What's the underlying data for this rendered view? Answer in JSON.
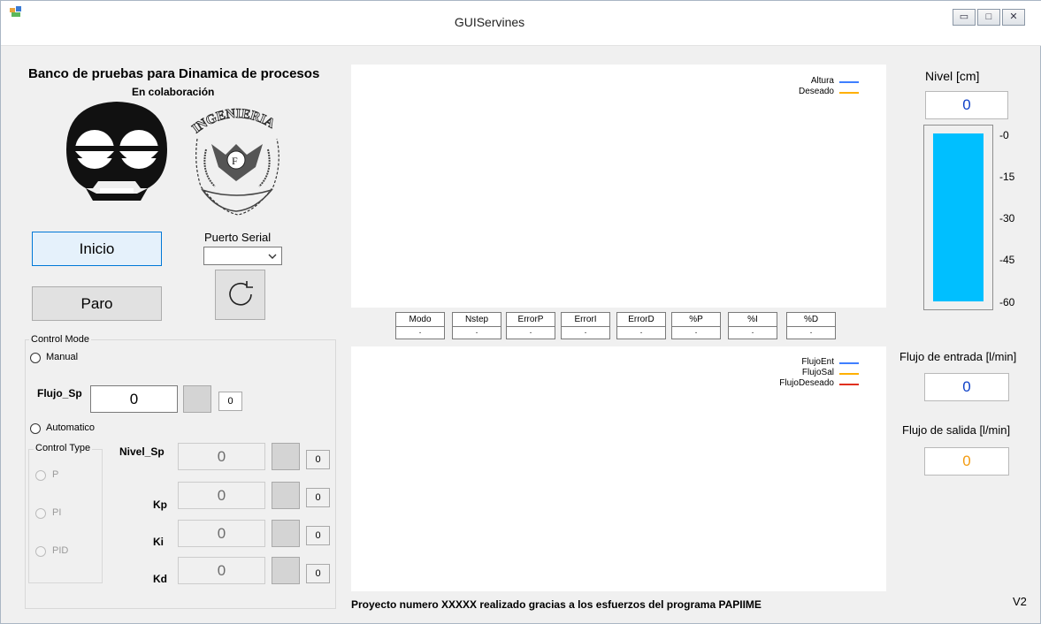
{
  "window": {
    "title": "GUIServines",
    "minimize_glyph": "▭",
    "maximize_glyph": "□",
    "close_glyph": "✕"
  },
  "header": {
    "title": "Banco de pruebas para Dinamica de procesos",
    "subtitle": "En colaboración",
    "seal_text": "INGENIERIA"
  },
  "controls": {
    "start_label": "Inicio",
    "stop_label": "Paro",
    "serial_port_label": "Puerto Serial",
    "serial_port_value": ""
  },
  "control_mode": {
    "title": "Control Mode",
    "manual_label": "Manual",
    "flujo_sp_label": "Flujo_Sp",
    "flujo_sp_value": "0",
    "flujo_sp_small": "0",
    "automatico_label": "Automatico",
    "control_type": {
      "title": "Control Type",
      "options": [
        "P",
        "PI",
        "PID"
      ]
    },
    "params": [
      {
        "label": "Nivel_Sp",
        "value": "0",
        "small": "0"
      },
      {
        "label": "Kp",
        "value": "0",
        "small": "0"
      },
      {
        "label": "Ki",
        "value": "0",
        "small": "0"
      },
      {
        "label": "Kd",
        "value": "0",
        "small": "0"
      }
    ]
  },
  "top_chart": {
    "legend": [
      {
        "name": "Altura",
        "color": "#3f7fff"
      },
      {
        "name": "Deseado",
        "color": "#ffb000"
      }
    ]
  },
  "bottom_chart": {
    "legend": [
      {
        "name": "FlujoEnt",
        "color": "#3f7fff"
      },
      {
        "name": "FlujoSal",
        "color": "#ffb000"
      },
      {
        "name": "FlujoDeseado",
        "color": "#e0301e"
      }
    ]
  },
  "status_table": {
    "columns": [
      {
        "header": "Modo",
        "value": "."
      },
      {
        "header": "Nstep",
        "value": "."
      },
      {
        "header": "ErrorP",
        "value": "."
      },
      {
        "header": "ErrorI",
        "value": "."
      },
      {
        "header": "ErrorD",
        "value": "."
      },
      {
        "header": "%P",
        "value": "."
      },
      {
        "header": "%I",
        "value": "."
      },
      {
        "header": "%D",
        "value": "."
      }
    ]
  },
  "level": {
    "label": "Nivel [cm]",
    "value": "0",
    "value_color": "#1042c8",
    "bar_color": "#00bfff",
    "ticks": [
      "-0",
      "-15",
      "-30",
      "-45",
      "-60"
    ]
  },
  "flow_in": {
    "label": "Flujo de entrada [l/min]",
    "value": "0",
    "color": "#1042c8"
  },
  "flow_out": {
    "label": "Flujo de salida [l/min]",
    "value": "0",
    "color": "#f39c12"
  },
  "footer": {
    "text": "Proyecto numero XXXXX realizado gracias a los esfuerzos del programa PAPIIME",
    "version": "V2"
  }
}
